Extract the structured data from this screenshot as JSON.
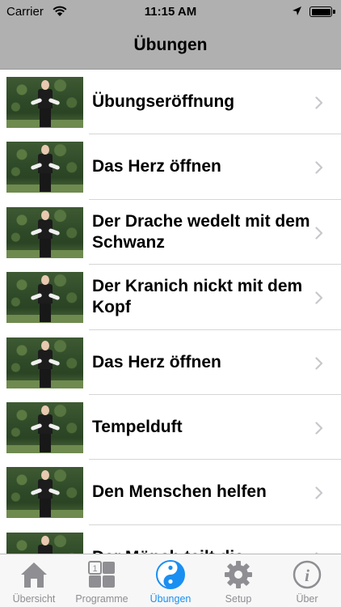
{
  "status_bar": {
    "carrier": "Carrier",
    "time": "11:15 AM"
  },
  "nav": {
    "title": "Übungen"
  },
  "exercises": [
    {
      "label": "Übungseröffnung"
    },
    {
      "label": "Das Herz öffnen"
    },
    {
      "label": "Der Drache wedelt mit dem Schwanz"
    },
    {
      "label": "Der Kranich nickt mit dem Kopf"
    },
    {
      "label": "Das Herz öffnen"
    },
    {
      "label": "Tempelduft"
    },
    {
      "label": "Den Menschen helfen"
    },
    {
      "label": "Der Mönch teilt die"
    }
  ],
  "tabs": [
    {
      "label": "Übersicht",
      "icon": "home-icon"
    },
    {
      "label": "Programme",
      "icon": "programs-grid-icon"
    },
    {
      "label": "Übungen",
      "icon": "yin-yang-icon",
      "active": true
    },
    {
      "label": "Setup",
      "icon": "gear-icon"
    },
    {
      "label": "Über",
      "icon": "info-icon"
    }
  ],
  "colors": {
    "accent": "#1a8ff2",
    "bar_gray": "#b0b0b0",
    "inactive_tab": "#8e8e93"
  }
}
